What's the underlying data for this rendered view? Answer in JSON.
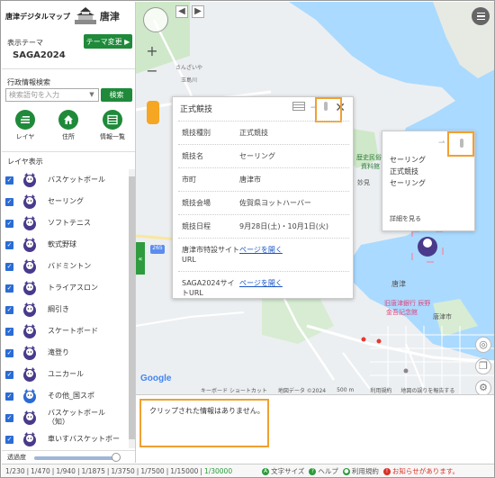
{
  "app": {
    "logo_text": "唐津デジタルマップ",
    "logo_brand": "唐津"
  },
  "sidebar": {
    "theme_label": "表示テーマ",
    "theme_change_button": "テーマ変更 ▶",
    "theme_value": "SAGA2024",
    "search_label": "行政情報検索",
    "search_placeholder": "検索語句を入力",
    "search_button": "検索",
    "tools": [
      {
        "label": "レイヤ",
        "icon": "layers-icon"
      },
      {
        "label": "住所",
        "icon": "home-icon"
      },
      {
        "label": "情報一覧",
        "icon": "list-icon"
      }
    ],
    "layer_title": "レイヤ表示",
    "layers": [
      {
        "name": "バスケットボール",
        "checked": true
      },
      {
        "name": "セーリング",
        "checked": true
      },
      {
        "name": "ソフトテニス",
        "checked": true
      },
      {
        "name": "軟式野球",
        "checked": true
      },
      {
        "name": "バドミントン",
        "checked": true
      },
      {
        "name": "トライアスロン",
        "checked": true
      },
      {
        "name": "綱引き",
        "checked": true
      },
      {
        "name": "スケートボード",
        "checked": true
      },
      {
        "name": "滝登り",
        "checked": true
      },
      {
        "name": "ユニカール",
        "checked": true
      },
      {
        "name": "その他_国スポ",
        "checked": true
      },
      {
        "name": "バスケットボール\n（知）",
        "checked": true
      },
      {
        "name": "車いすバスケットボー",
        "checked": true
      }
    ],
    "opacity_label": "透過度",
    "opacity_value": 0.95
  },
  "map": {
    "labels": {
      "road_265": "265",
      "weather": "天気情報",
      "yacht": "海岸",
      "city_karatsu": "唐津市",
      "karatsu": "唐津",
      "karatsu_station": "旧唐津銀行 辰野 金吾記念館",
      "flower": "和多田",
      "ishi": "石志",
      "keyboard": "キーボード ショートカット",
      "mapdata": "地図データ ©2024",
      "scale": "500 m",
      "terms": "利用規約",
      "report": "地図の誤りを報告する"
    },
    "google": "Google"
  },
  "popup": {
    "title": "正式競技",
    "rows": [
      {
        "key": "競技種別",
        "value": "正式競技"
      },
      {
        "key": "競技名",
        "value": "セーリング"
      },
      {
        "key": "市町",
        "value": "唐津市"
      },
      {
        "key": "競技会場",
        "value": "佐賀県ヨットハーバー"
      },
      {
        "key": "競技日程",
        "value": "9月28日(土)・10月1日(火)"
      },
      {
        "key": "唐津市特設サイトURL",
        "value": "ページを開く",
        "link": true
      },
      {
        "key": "SAGA2024サイトURL",
        "value": "ページを開く",
        "link": true
      }
    ]
  },
  "popup2": {
    "lines": [
      "セーリング",
      "正式競技",
      "セーリング"
    ],
    "more": "詳細を見る"
  },
  "clip": {
    "text": "クリップされた情報はありません。"
  },
  "footer": {
    "scales": [
      "1/230",
      "1/470",
      "1/940",
      "1/1875",
      "1/3750",
      "1/7500",
      "1/15000",
      "1/30000"
    ],
    "active_scale": "1/30000",
    "text_size": "文字サイズ",
    "help": "ヘルプ",
    "terms": "利用規約",
    "notice": "お知らせがあります。"
  },
  "colors": {
    "accent_green": "#1f8a3a",
    "checkbox_blue": "#2b6cd4",
    "sea": "#aadaff",
    "highlight_orange": "#f0a030",
    "link_blue": "#1a55c6",
    "alert_red": "#d93025"
  }
}
